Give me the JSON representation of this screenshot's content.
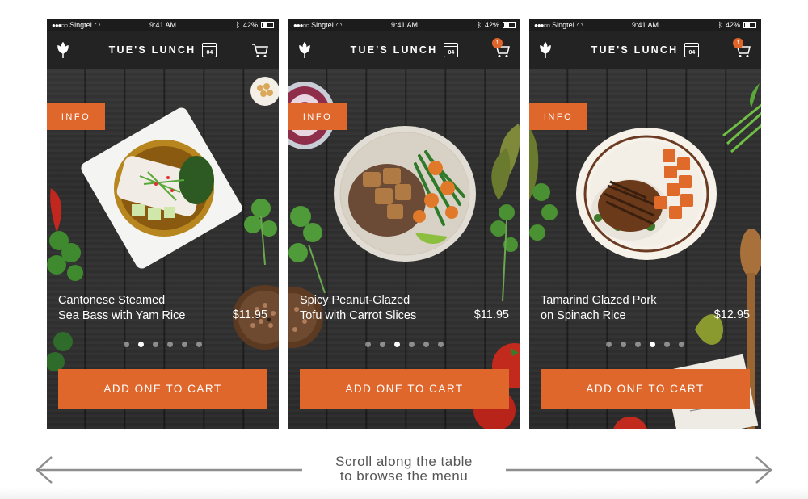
{
  "status_bar": {
    "carrier": "Singtel",
    "time": "9:41 AM",
    "battery": "42%"
  },
  "app": {
    "title": "TUE'S LUNCH",
    "calendar_day": "04",
    "info_label": "INFO",
    "add_button_label": "ADD ONE TO CART",
    "cart_badge_count": "1",
    "accent_color": "#e0672c"
  },
  "screens": [
    {
      "name": "Cantonese Steamed",
      "name_line2": "Sea Bass with Yam Rice",
      "price": "$11.95",
      "active_page": 2,
      "total_pages": 6,
      "cart_has_badge": false
    },
    {
      "name": "Spicy Peanut-Glazed",
      "name_line2": "Tofu with Carrot Slices",
      "price": "$11.95",
      "active_page": 3,
      "total_pages": 6,
      "cart_has_badge": true
    },
    {
      "name": "Tamarind Glazed Pork",
      "name_line2": "on Spinach Rice",
      "price": "$12.95",
      "active_page": 4,
      "total_pages": 6,
      "cart_has_badge": true
    }
  ],
  "hint": {
    "line1": "Scroll along the table",
    "line2": "to browse the menu"
  }
}
